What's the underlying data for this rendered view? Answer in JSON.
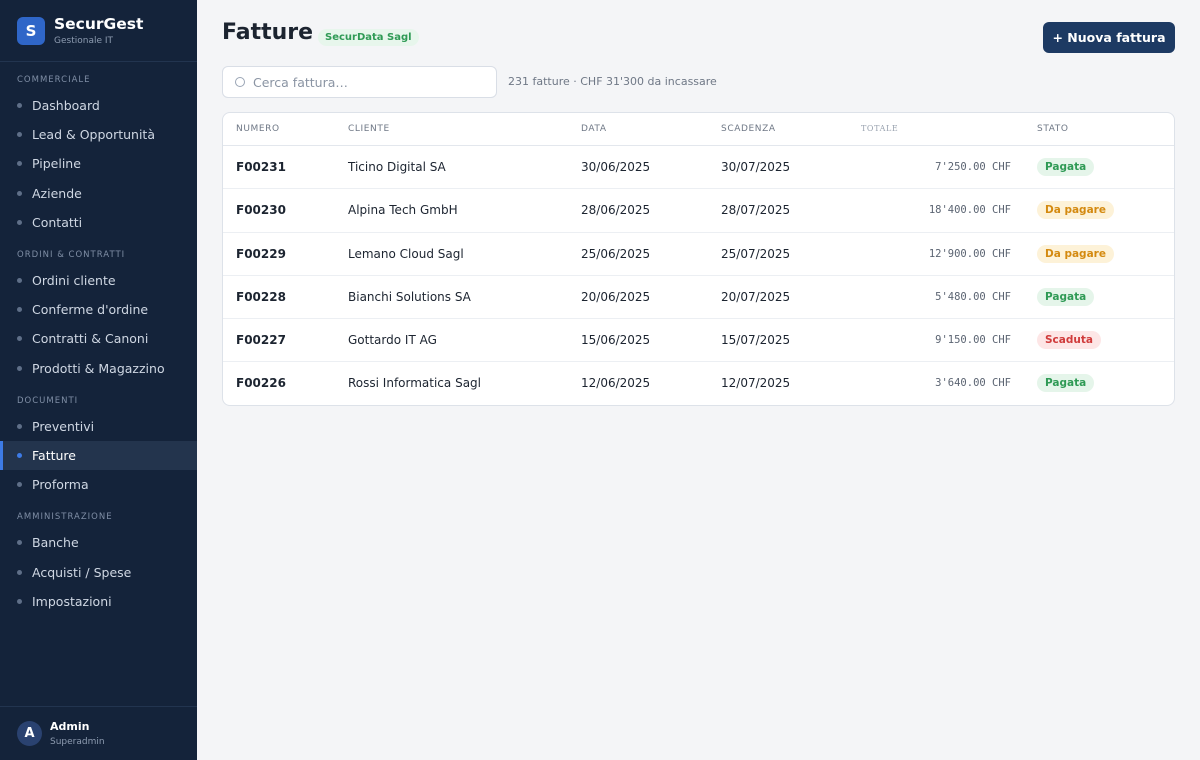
{
  "brand": {
    "logo_letter": "S",
    "name": "SecurGest",
    "subtitle": "Gestionale IT"
  },
  "sidebar": {
    "sections": [
      {
        "title": "COMMERCIALE",
        "items": [
          "Dashboard",
          "Lead & Opportunità",
          "Pipeline",
          "Aziende",
          "Contatti"
        ]
      },
      {
        "title": "ORDINI & CONTRATTI",
        "items": [
          "Ordini cliente",
          "Conferme d'ordine",
          "Contratti & Canoni",
          "Prodotti & Magazzino"
        ]
      },
      {
        "title": "DOCUMENTI",
        "items": [
          "Preventivi",
          "Fatture",
          "Proforma"
        ]
      },
      {
        "title": "AMMINISTRAZIONE",
        "items": [
          "Banche",
          "Acquisti / Spese",
          "Impostazioni"
        ]
      }
    ],
    "active_item": "Fatture"
  },
  "user": {
    "initial": "A",
    "name": "Admin",
    "role": "Superadmin"
  },
  "header": {
    "title": "Fatture",
    "company_badge": "SecurData Sagl",
    "new_button": "+ Nuova fattura"
  },
  "search": {
    "placeholder": "Cerca fattura…",
    "value": ""
  },
  "summary": "231 fatture · CHF 31'300 da incassare",
  "table": {
    "columns": [
      "NUMERO",
      "CLIENTE",
      "DATA",
      "SCADENZA",
      "TOTALE",
      "STATO"
    ],
    "rows": [
      {
        "numero": "F00231",
        "cliente": "Ticino Digital SA",
        "data": "30/06/2025",
        "scadenza": "30/07/2025",
        "totale": "7'250.00 CHF",
        "stato": "Pagata",
        "stato_type": "paid"
      },
      {
        "numero": "F00230",
        "cliente": "Alpina Tech GmbH",
        "data": "28/06/2025",
        "scadenza": "28/07/2025",
        "totale": "18'400.00 CHF",
        "stato": "Da pagare",
        "stato_type": "due"
      },
      {
        "numero": "F00229",
        "cliente": "Lemano Cloud Sagl",
        "data": "25/06/2025",
        "scadenza": "25/07/2025",
        "totale": "12'900.00 CHF",
        "stato": "Da pagare",
        "stato_type": "due"
      },
      {
        "numero": "F00228",
        "cliente": "Bianchi Solutions SA",
        "data": "20/06/2025",
        "scadenza": "20/07/2025",
        "totale": "5'480.00 CHF",
        "stato": "Pagata",
        "stato_type": "paid"
      },
      {
        "numero": "F00227",
        "cliente": "Gottardo IT AG",
        "data": "15/06/2025",
        "scadenza": "15/07/2025",
        "totale": "9'150.00 CHF",
        "stato": "Scaduta",
        "stato_type": "over"
      },
      {
        "numero": "F00226",
        "cliente": "Rossi Informatica Sagl",
        "data": "12/06/2025",
        "scadenza": "12/07/2025",
        "totale": "3'640.00 CHF",
        "stato": "Pagata",
        "stato_type": "paid"
      }
    ]
  },
  "colors": {
    "sidebar_bg": "#14233a",
    "accent": "#2f66c8",
    "primary_button": "#1d3a63",
    "paid": "#2f9a55",
    "due": "#d48a10",
    "overdue": "#d03b3b"
  }
}
